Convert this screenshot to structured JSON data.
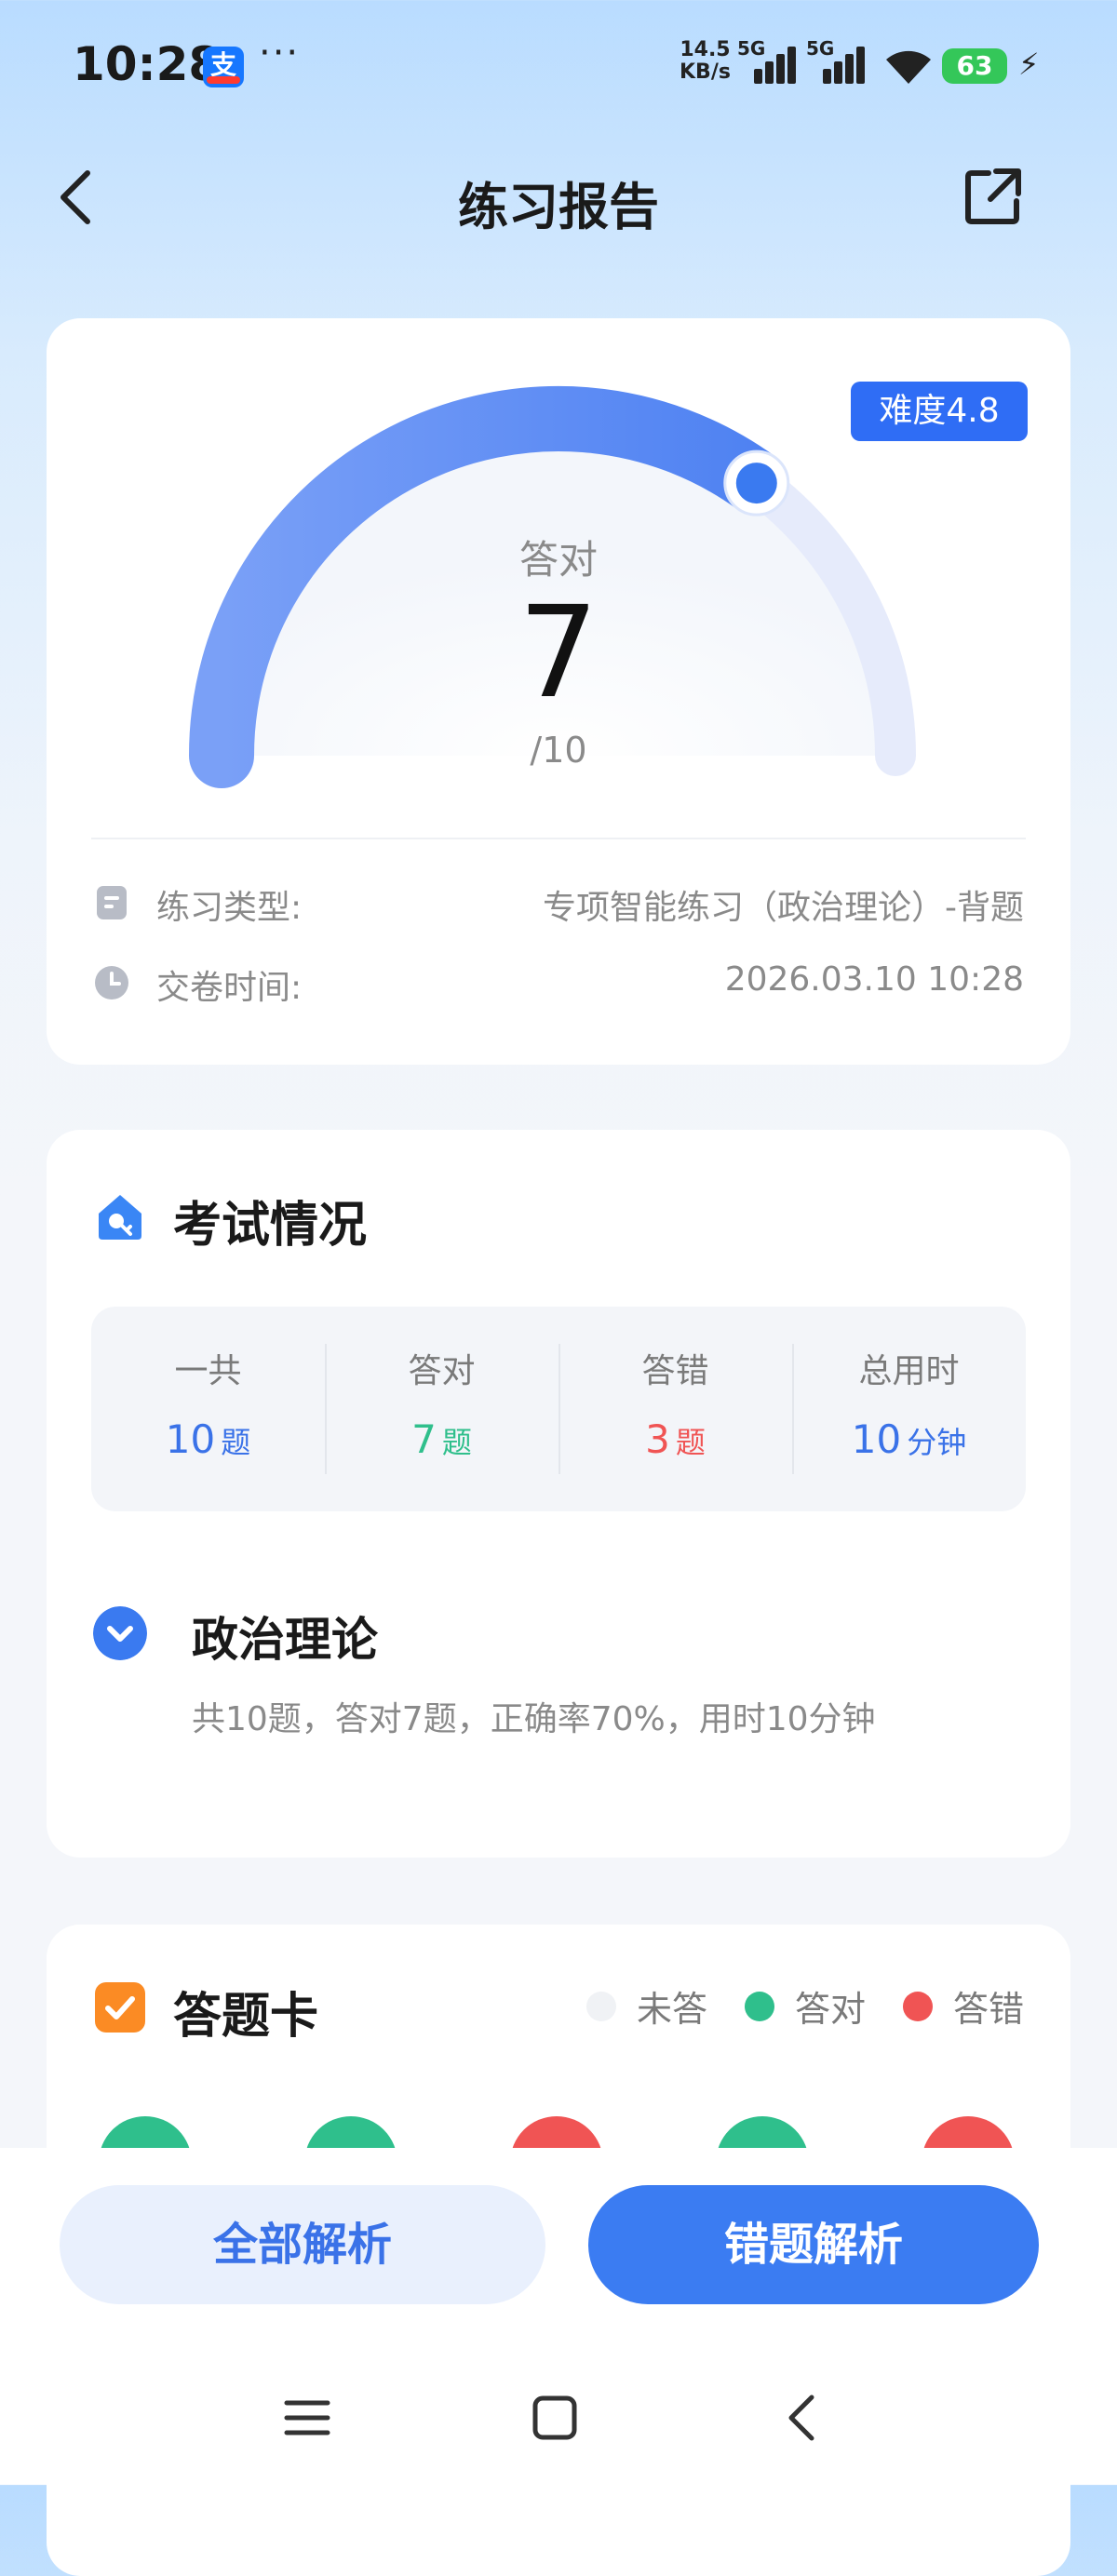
{
  "status_bar": {
    "time": "10:28",
    "app_icon": "alipay-icon",
    "more": "···",
    "net_speed_value": "14.5",
    "net_speed_unit": "KB/s",
    "sim1_label": "5G",
    "sim2_label": "5G",
    "battery": "63"
  },
  "header": {
    "title": "练习报告"
  },
  "report": {
    "difficulty": "难度4.8",
    "correct_label": "答对",
    "correct_count": "7",
    "total": "/10",
    "progress": 0.7,
    "practice_type_label": "练习类型:",
    "practice_type_value": "专项智能练习（政治理论）-背题",
    "submit_time_label": "交卷时间:",
    "submit_time_value": "2026.03.10 10:28"
  },
  "exam": {
    "title": "考试情况",
    "stats": [
      {
        "label": "一共",
        "value": "10",
        "unit": "题",
        "color": "#3a72e8"
      },
      {
        "label": "答对",
        "value": "7",
        "unit": "题",
        "color": "#2fbf8c"
      },
      {
        "label": "答错",
        "value": "3",
        "unit": "题",
        "color": "#f05454"
      },
      {
        "label": "总用时",
        "value": "10",
        "unit": "分钟",
        "color": "#3a72e8"
      }
    ],
    "subject": {
      "title": "政治理论",
      "desc": "共10题，答对7题，正确率70%，用时10分钟"
    }
  },
  "answer_card": {
    "title": "答题卡",
    "legend": [
      {
        "label": "未答",
        "color": "#f0f2f5"
      },
      {
        "label": "答对",
        "color": "#2fbf8c"
      },
      {
        "label": "答错",
        "color": "#f05454"
      }
    ],
    "questions": [
      "correct",
      "correct",
      "wrong",
      "correct",
      "wrong"
    ]
  },
  "colors": {
    "correct": "#2fbf8c",
    "wrong": "#f05454",
    "accent": "#3b7cf2"
  },
  "actions": {
    "all_analysis": "全部解析",
    "wrong_analysis": "错题解析"
  }
}
